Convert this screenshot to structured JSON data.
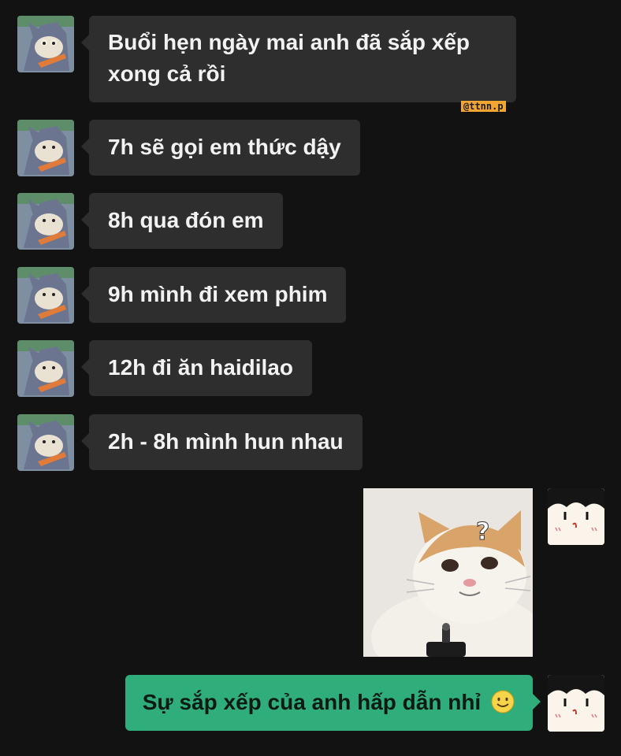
{
  "watermark": "@ttnn.p",
  "messages_in": [
    {
      "text": "Buổi hẹn ngày mai anh đã sắp xếp",
      "text2": "xong cả rồi"
    },
    {
      "text": "7h sẽ gọi em thức dậy"
    },
    {
      "text": "8h qua đón em"
    },
    {
      "text": "9h mình đi xem phim"
    },
    {
      "text": "12h đi ăn haidilao"
    },
    {
      "text": "2h - 8h mình hun nhau"
    }
  ],
  "sticker": {
    "icon": "confused-cat-sticker",
    "mark": "?"
  },
  "message_out": {
    "text": "Sự sắp xếp của anh hấp dẫn nhỉ",
    "emoji": "smiling-face-emoji"
  },
  "avatars": {
    "left": "tom-cat-avatar",
    "right": "cartoon-girl-avatar"
  },
  "colors": {
    "background": "#121212",
    "incoming_bubble": "#2e2e2e",
    "outgoing_bubble": "#2fae7b",
    "watermark": "#f2a531"
  }
}
